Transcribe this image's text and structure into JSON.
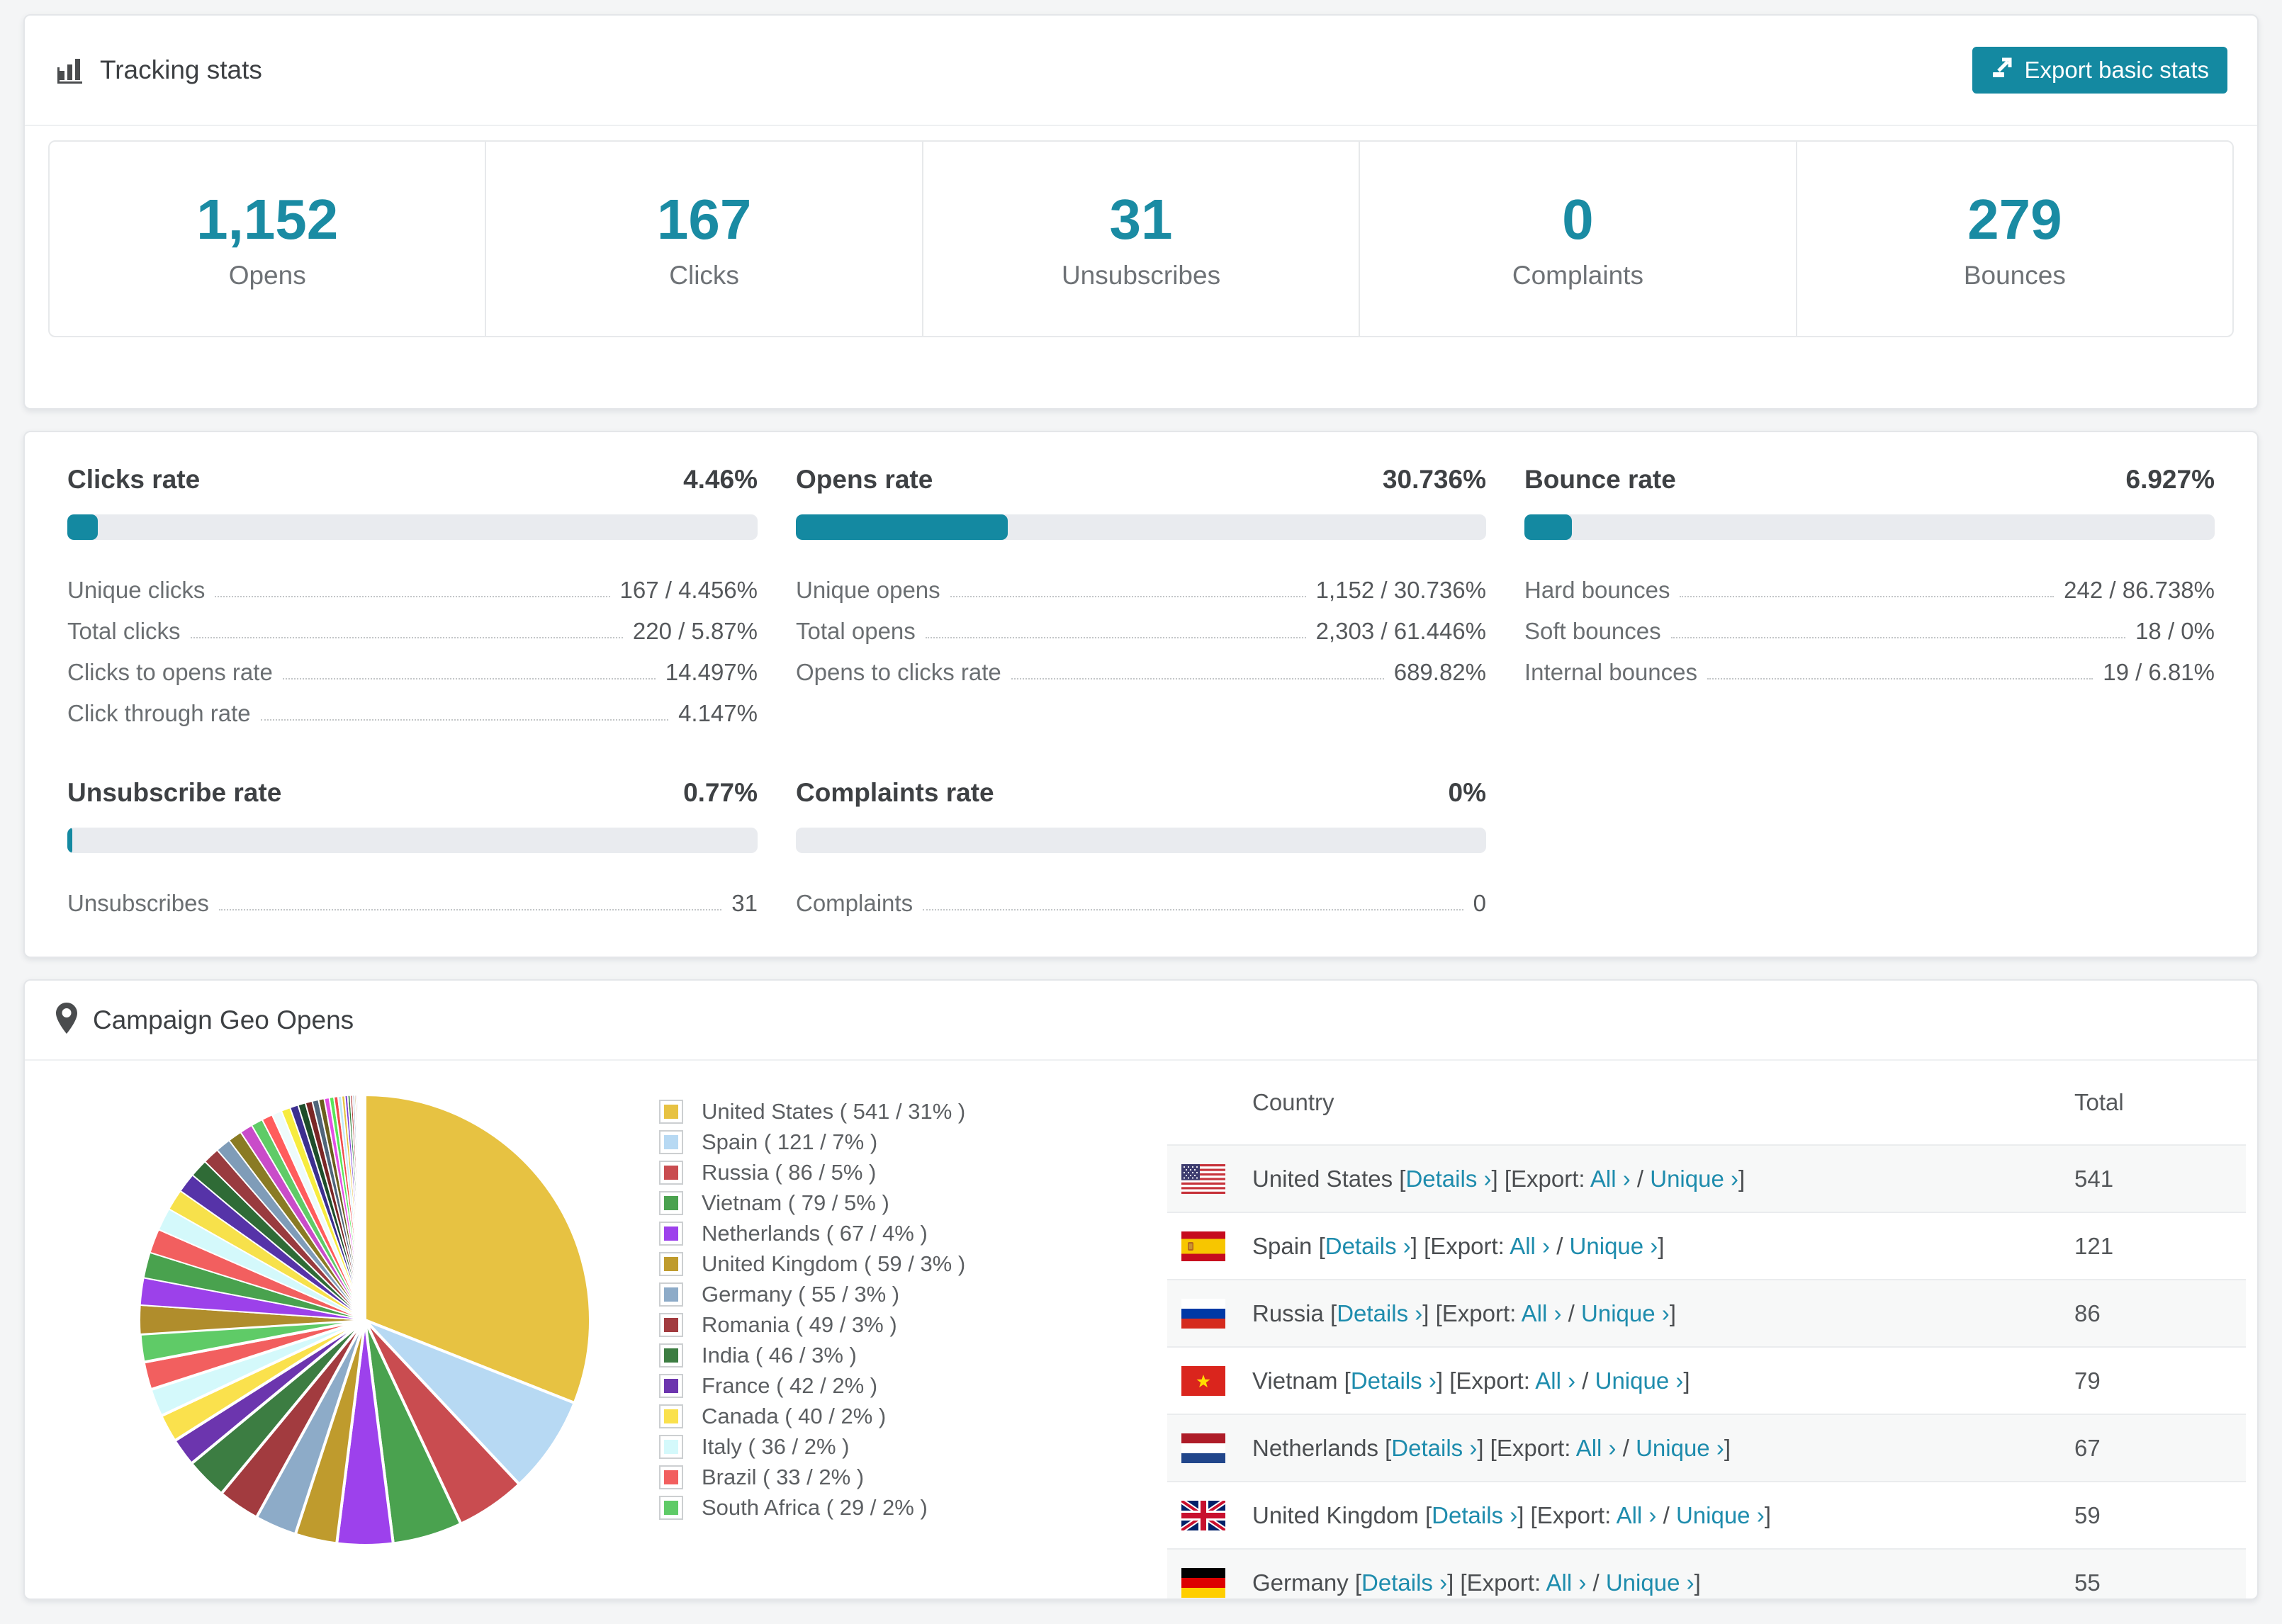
{
  "theme": {
    "accent": "#1489a1",
    "accent_text": "#1a8ba3",
    "link_color": "#1e8cad",
    "bar_track": "#e9ebef",
    "page_bg": "#f4f5f6",
    "card_border": "#e4e6e9"
  },
  "tracking": {
    "title": "Tracking stats",
    "export_button": "Export basic stats",
    "summary": [
      {
        "value": "1,152",
        "label": "Opens"
      },
      {
        "value": "167",
        "label": "Clicks"
      },
      {
        "value": "31",
        "label": "Unsubscribes"
      },
      {
        "value": "0",
        "label": "Complaints"
      },
      {
        "value": "279",
        "label": "Bounces"
      }
    ]
  },
  "rates": {
    "blocks": [
      {
        "title": "Clicks rate",
        "value": "4.46%",
        "pct": 4.46,
        "rows": [
          {
            "label": "Unique clicks",
            "value": "167 / 4.456%"
          },
          {
            "label": "Total clicks",
            "value": "220 / 5.87%"
          },
          {
            "label": "Clicks to opens rate",
            "value": "14.497%"
          },
          {
            "label": "Click through rate",
            "value": "4.147%"
          }
        ]
      },
      {
        "title": "Opens rate",
        "value": "30.736%",
        "pct": 30.736,
        "rows": [
          {
            "label": "Unique opens",
            "value": "1,152 / 30.736%"
          },
          {
            "label": "Total opens",
            "value": "2,303 / 61.446%"
          },
          {
            "label": "Opens to clicks rate",
            "value": "689.82%"
          }
        ]
      },
      {
        "title": "Bounce rate",
        "value": "6.927%",
        "pct": 6.927,
        "rows": [
          {
            "label": "Hard bounces",
            "value": "242 / 86.738%"
          },
          {
            "label": "Soft bounces",
            "value": "18 / 0%"
          },
          {
            "label": "Internal bounces",
            "value": "19 / 6.81%"
          }
        ]
      },
      {
        "title": "Unsubscribe rate",
        "value": "0.77%",
        "pct": 0.77,
        "rows": [
          {
            "label": "Unsubscribes",
            "value": "31"
          }
        ]
      },
      {
        "title": "Complaints rate",
        "value": "0%",
        "pct": 0,
        "rows": [
          {
            "label": "Complaints",
            "value": "0"
          }
        ]
      }
    ]
  },
  "geo": {
    "title": "Campaign Geo Opens",
    "table": {
      "columns": [
        "Country",
        "Total"
      ],
      "links": {
        "open": "[",
        "close": "]",
        "details": "Details ›",
        "export_label": "Export:",
        "all": "All ›",
        "slash": "/",
        "unique": "Unique ›"
      },
      "rows": [
        {
          "country": "United States",
          "total": "541",
          "flag": "us"
        },
        {
          "country": "Spain",
          "total": "121",
          "flag": "es"
        },
        {
          "country": "Russia",
          "total": "86",
          "flag": "ru"
        },
        {
          "country": "Vietnam",
          "total": "79",
          "flag": "vn"
        },
        {
          "country": "Netherlands",
          "total": "67",
          "flag": "nl"
        },
        {
          "country": "United Kingdom",
          "total": "59",
          "flag": "gb"
        },
        {
          "country": "Germany",
          "total": "55",
          "flag": "de"
        }
      ]
    }
  },
  "chart_data": {
    "type": "pie",
    "title": "Campaign Geo Opens",
    "legend_position": "right",
    "legend_format": "{label} ( {value} / {pct}% )",
    "start_angle_deg": 0,
    "direction": "clockwise",
    "slices": [
      {
        "label": "United States",
        "value": 541,
        "pct": 31,
        "color": "#e7c242"
      },
      {
        "label": "Spain",
        "value": 121,
        "pct": 7,
        "color": "#b7d9f3"
      },
      {
        "label": "Russia",
        "value": 86,
        "pct": 5,
        "color": "#c94c50"
      },
      {
        "label": "Vietnam",
        "value": 79,
        "pct": 5,
        "color": "#4aa24f"
      },
      {
        "label": "Netherlands",
        "value": 67,
        "pct": 4,
        "color": "#9d41ec"
      },
      {
        "label": "United Kingdom",
        "value": 59,
        "pct": 3,
        "color": "#bf9b2d"
      },
      {
        "label": "Germany",
        "value": 55,
        "pct": 3,
        "color": "#8dabc8"
      },
      {
        "label": "Romania",
        "value": 49,
        "pct": 3,
        "color": "#a23b3f"
      },
      {
        "label": "India",
        "value": 46,
        "pct": 3,
        "color": "#3c7d42"
      },
      {
        "label": "France",
        "value": 42,
        "pct": 2,
        "color": "#6c35ae"
      },
      {
        "label": "Canada",
        "value": 40,
        "pct": 2,
        "color": "#fae14d"
      },
      {
        "label": "Italy",
        "value": 36,
        "pct": 2,
        "color": "#d4f9fb"
      },
      {
        "label": "Brazil",
        "value": 33,
        "pct": 2,
        "color": "#f25f5f"
      },
      {
        "label": "South Africa",
        "value": 29,
        "pct": 2,
        "color": "#5fcb67"
      }
    ],
    "others_unlabeled": {
      "total_pct": 26,
      "weights": [
        1.9,
        1.8,
        1.7,
        1.6,
        1.5,
        1.4,
        1.3,
        1.2,
        1.1,
        1.0,
        0.92,
        0.85,
        0.78,
        0.72,
        0.66,
        0.6,
        0.55,
        0.5,
        0.46,
        0.42,
        0.38,
        0.34,
        0.3,
        0.27,
        0.24,
        0.21,
        0.19,
        0.17,
        0.15,
        0.13,
        0.11,
        0.1,
        0.09,
        0.08,
        0.07,
        0.06,
        0.05,
        0.045,
        0.04,
        0.035
      ],
      "palette": [
        "#b08d2c",
        "#9c41ea",
        "#49a24e",
        "#f25f5f",
        "#d4f9fb",
        "#f7e14b",
        "#5633a8",
        "#2f6b36",
        "#993b3f",
        "#7f9cb8",
        "#8a7b24",
        "#c94cc9",
        "#5fcb67",
        "#ff5c5c",
        "#eefbfb",
        "#f7ec3f",
        "#3c2f8f",
        "#1e4d2b",
        "#7a2626",
        "#50657a",
        "#6b5e1e",
        "#e44fe4",
        "#59e659",
        "#f04b4b",
        "#bfe9f7",
        "#e7c242",
        "#7a3fd4",
        "#2f7d35",
        "#b03535",
        "#8dabc8"
      ]
    }
  }
}
